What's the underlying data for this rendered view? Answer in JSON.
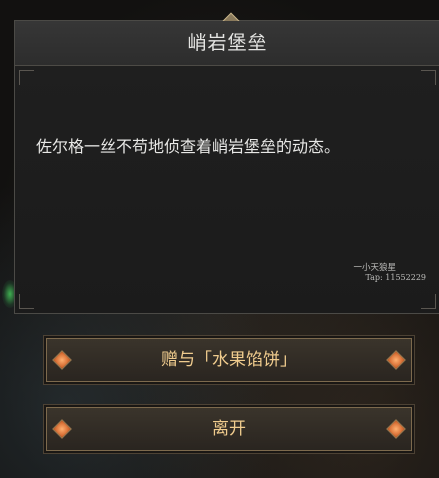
{
  "dialog": {
    "title": "峭岩堡垒",
    "text": "佐尔格一丝不苟地侦查着峭岩堡垒的动态。",
    "watermark_name": "一小天狼星",
    "watermark_tap": "Tap: 11552229"
  },
  "options": [
    {
      "label": "赠与「水果馅饼」"
    },
    {
      "label": "离开"
    }
  ],
  "colors": {
    "option_text": "#f0cc8e",
    "dialog_bg": "#232323",
    "accent_gem": "#c8561f"
  },
  "icons": [
    "diamond-gem-icon"
  ]
}
